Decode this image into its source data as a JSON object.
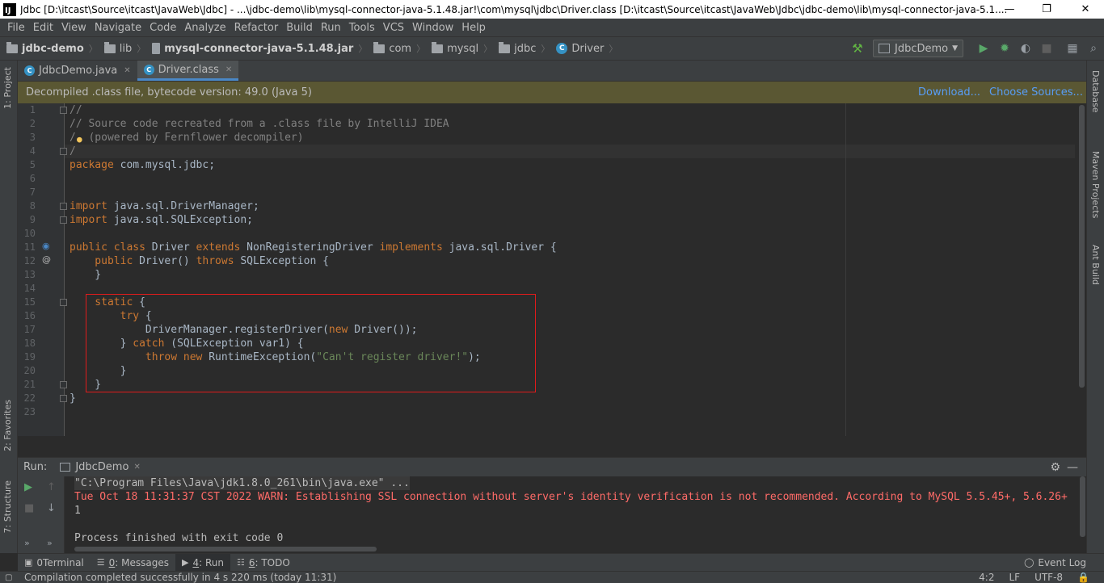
{
  "window": {
    "title": "Jdbc [D:\\itcast\\Source\\itcast\\JavaWeb\\Jdbc] - ...\\jdbc-demo\\lib\\mysql-connector-java-5.1.48.jar!\\com\\mysql\\jdbc\\Driver.class [D:\\itcast\\Source\\itcast\\JavaWeb\\Jdbc\\jdbc-demo\\lib\\mysql-connector-java-5.1....",
    "logo": "IJ",
    "minimize": "—",
    "maximize": "❐",
    "close": "✕"
  },
  "menu": [
    "File",
    "Edit",
    "View",
    "Navigate",
    "Code",
    "Analyze",
    "Refactor",
    "Build",
    "Run",
    "Tools",
    "VCS",
    "Window",
    "Help"
  ],
  "breadcrumb": [
    "jdbc-demo",
    "lib",
    "mysql-connector-java-5.1.48.jar",
    "com",
    "mysql",
    "jdbc",
    "Driver"
  ],
  "run_config": "JdbcDemo",
  "editor_tabs": [
    {
      "label": "JdbcDemo.java",
      "active": false
    },
    {
      "label": "Driver.class",
      "active": true
    }
  ],
  "banner": {
    "text": "Decompiled .class file, bytecode version: 49.0 (Java 5)",
    "download": "Download...",
    "choose_sources": "Choose Sources..."
  },
  "line_numbers": [
    "1",
    "2",
    "3",
    "4",
    "5",
    "6",
    "7",
    "8",
    "9",
    "10",
    "11",
    "12",
    "13",
    "14",
    "15",
    "16",
    "17",
    "18",
    "19",
    "20",
    "21",
    "22",
    "23"
  ],
  "code": {
    "l1": "//",
    "l2": "// Source code recreated from a .class file by IntelliJ IDEA",
    "l3": "/  (powered by Fernflower decompiler)",
    "l4": "/",
    "l6a": "package",
    "l6b": " com.mysql.jdbc;",
    "l8a": "import",
    "l8b": " java.sql.DriverManager;",
    "l9a": "import",
    "l9b": " java.sql.SQLException;",
    "l11a": "public class",
    "l11b": " Driver ",
    "l11c": "extends",
    "l11d": " NonRegisteringDriver ",
    "l11e": "implements",
    "l11f": " java.sql.Driver {",
    "l12a": "    public",
    "l12b": " Driver() ",
    "l12c": "throws",
    "l12d": " SQLException {",
    "l13": "    }",
    "l15a": "    static",
    "l15b": " {",
    "l16a": "        try",
    "l16b": " {",
    "l17a": "            DriverManager.registerDriver(",
    "l17b": "new",
    "l17c": " Driver());",
    "l18a": "        } ",
    "l18b": "catch",
    "l18c": " (SQLException var1) {",
    "l19a": "            throw new",
    "l19b": " RuntimeException(",
    "l19c": "\"Can't register driver!\"",
    "l19d": ");",
    "l20": "        }",
    "l21": "    }",
    "l22": "}"
  },
  "run_panel": {
    "label": "Run:",
    "tab": "JdbcDemo"
  },
  "console": [
    "\"C:\\Program Files\\Java\\jdk1.8.0_261\\bin\\java.exe\" ...",
    "Tue Oct 18 11:31:37 CST 2022 WARN: Establishing SSL connection without server's identity verification is not recommended. According to MySQL 5.5.45+, 5.6.26+",
    "1",
    "",
    "Process finished with exit code 0"
  ],
  "left_tabs": [
    "1: Project",
    "2: Favorites",
    "7: Structure"
  ],
  "right_tabs": [
    "Database",
    "Maven Projects",
    "Ant Build"
  ],
  "tool_windows": [
    {
      "key": "",
      "label": "Terminal"
    },
    {
      "key": "0",
      "label": ": Messages"
    },
    {
      "key": "4",
      "label": ": Run"
    },
    {
      "key": "6",
      "label": ": TODO"
    }
  ],
  "event_log": "Event Log",
  "status": {
    "message": "Compilation completed successfully in 4 s 220 ms (today 11:31)",
    "position": "4:2",
    "line_sep": "LF",
    "encoding": "UTF-8"
  },
  "colors": {
    "keyword": "#cc7832",
    "comment": "#808080",
    "string": "#6a8759",
    "error": "#ff6b68",
    "highlight_box": "#e01b1b"
  }
}
